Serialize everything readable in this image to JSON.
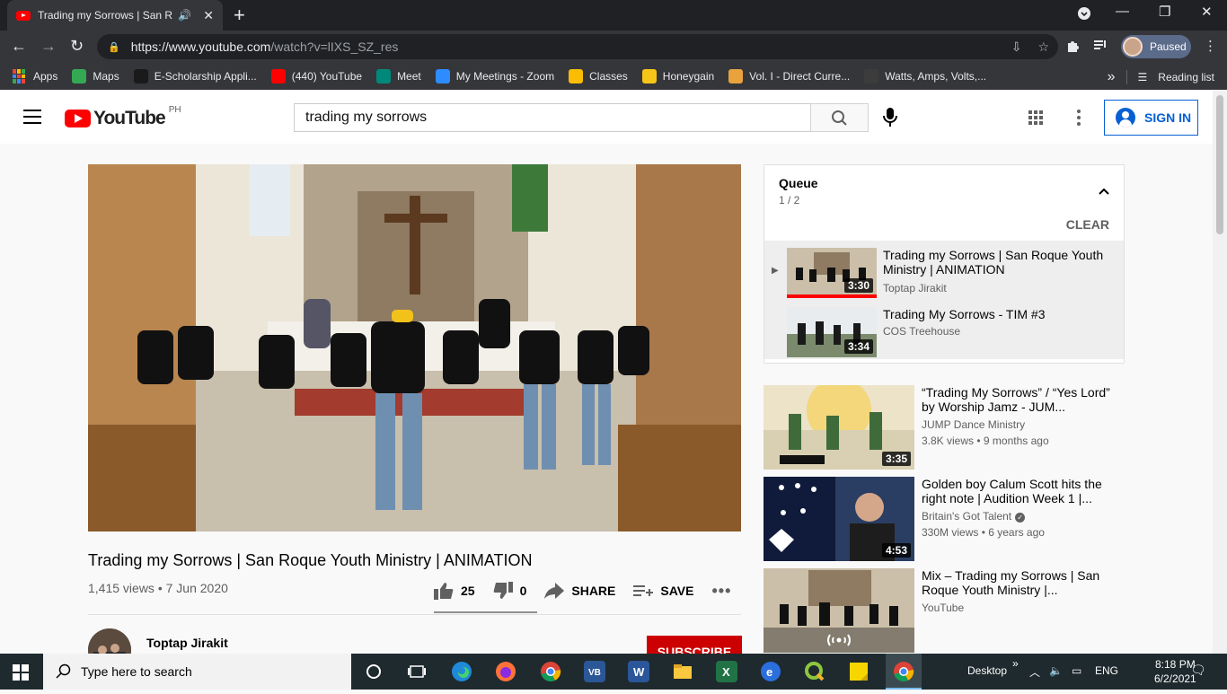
{
  "browser": {
    "tab_title": "Trading my Sorrows | San Ro",
    "url_host": "https://www.youtube.com",
    "url_path": "/watch?v=lIXS_SZ_res",
    "profile_status": "Paused",
    "new_tab_symbol": "+",
    "bookmarks": [
      {
        "label": "Apps",
        "color": "#f4b400"
      },
      {
        "label": "Maps",
        "color": "#34a853"
      },
      {
        "label": "E-Scholarship Appli...",
        "color": "#1a1a1a"
      },
      {
        "label": "(440) YouTube",
        "color": "#ff0000"
      },
      {
        "label": "Meet",
        "color": "#00897b"
      },
      {
        "label": "My Meetings - Zoom",
        "color": "#2d8cff"
      },
      {
        "label": "Classes",
        "color": "#fbbc04"
      },
      {
        "label": "Honeygain",
        "color": "#f5c518"
      },
      {
        "label": "Vol. I - Direct Curre...",
        "color": "#e8a33d"
      },
      {
        "label": "Watts, Amps, Volts,...",
        "color": "#3c3c3c"
      }
    ],
    "bookmarks_overflow": "»",
    "reading_list": "Reading list"
  },
  "youtube": {
    "logo_text": "YouTube",
    "country_code": "PH",
    "search_value": "trading my sorrows",
    "sign_in": "SIGN IN"
  },
  "video": {
    "title": "Trading my Sorrows | San Roque Youth Ministry | ANIMATION",
    "views": "1,415 views",
    "date": "7 Jun 2020",
    "likes": "25",
    "dislikes": "0",
    "share": "SHARE",
    "save": "SAVE",
    "channel": "Toptap Jirakit",
    "subscribe": "SUBSCRIBE"
  },
  "queue": {
    "title": "Queue",
    "count": "1 / 2",
    "clear": "CLEAR",
    "items": [
      {
        "title": "Trading my Sorrows | San Roque Youth Ministry | ANIMATION",
        "channel": "Toptap Jirakit",
        "duration": "3:30",
        "playing": true
      },
      {
        "title": "Trading My Sorrows - TIM #3",
        "channel": "COS Treehouse",
        "duration": "3:34",
        "playing": false
      }
    ]
  },
  "related": [
    {
      "title": "“Trading My Sorrows” / “Yes Lord” by Worship Jamz - JUM...",
      "channel": "JUMP Dance Ministry",
      "views": "3.8K views",
      "age": "9 months ago",
      "duration": "3:35",
      "verified": false
    },
    {
      "title": "Golden boy Calum Scott hits the right note | Audition Week 1 |...",
      "channel": "Britain's Got Talent",
      "views": "330M views",
      "age": "6 years ago",
      "duration": "4:53",
      "verified": true
    },
    {
      "title": "Mix – Trading my Sorrows | San Roque Youth Ministry |...",
      "channel": "YouTube",
      "views": "",
      "age": "",
      "duration": "",
      "verified": false
    }
  ],
  "taskbar": {
    "search_placeholder": "Type here to search",
    "desktop": "Desktop",
    "language": "ENG",
    "time": "8:18 PM",
    "date": "6/2/2021"
  }
}
